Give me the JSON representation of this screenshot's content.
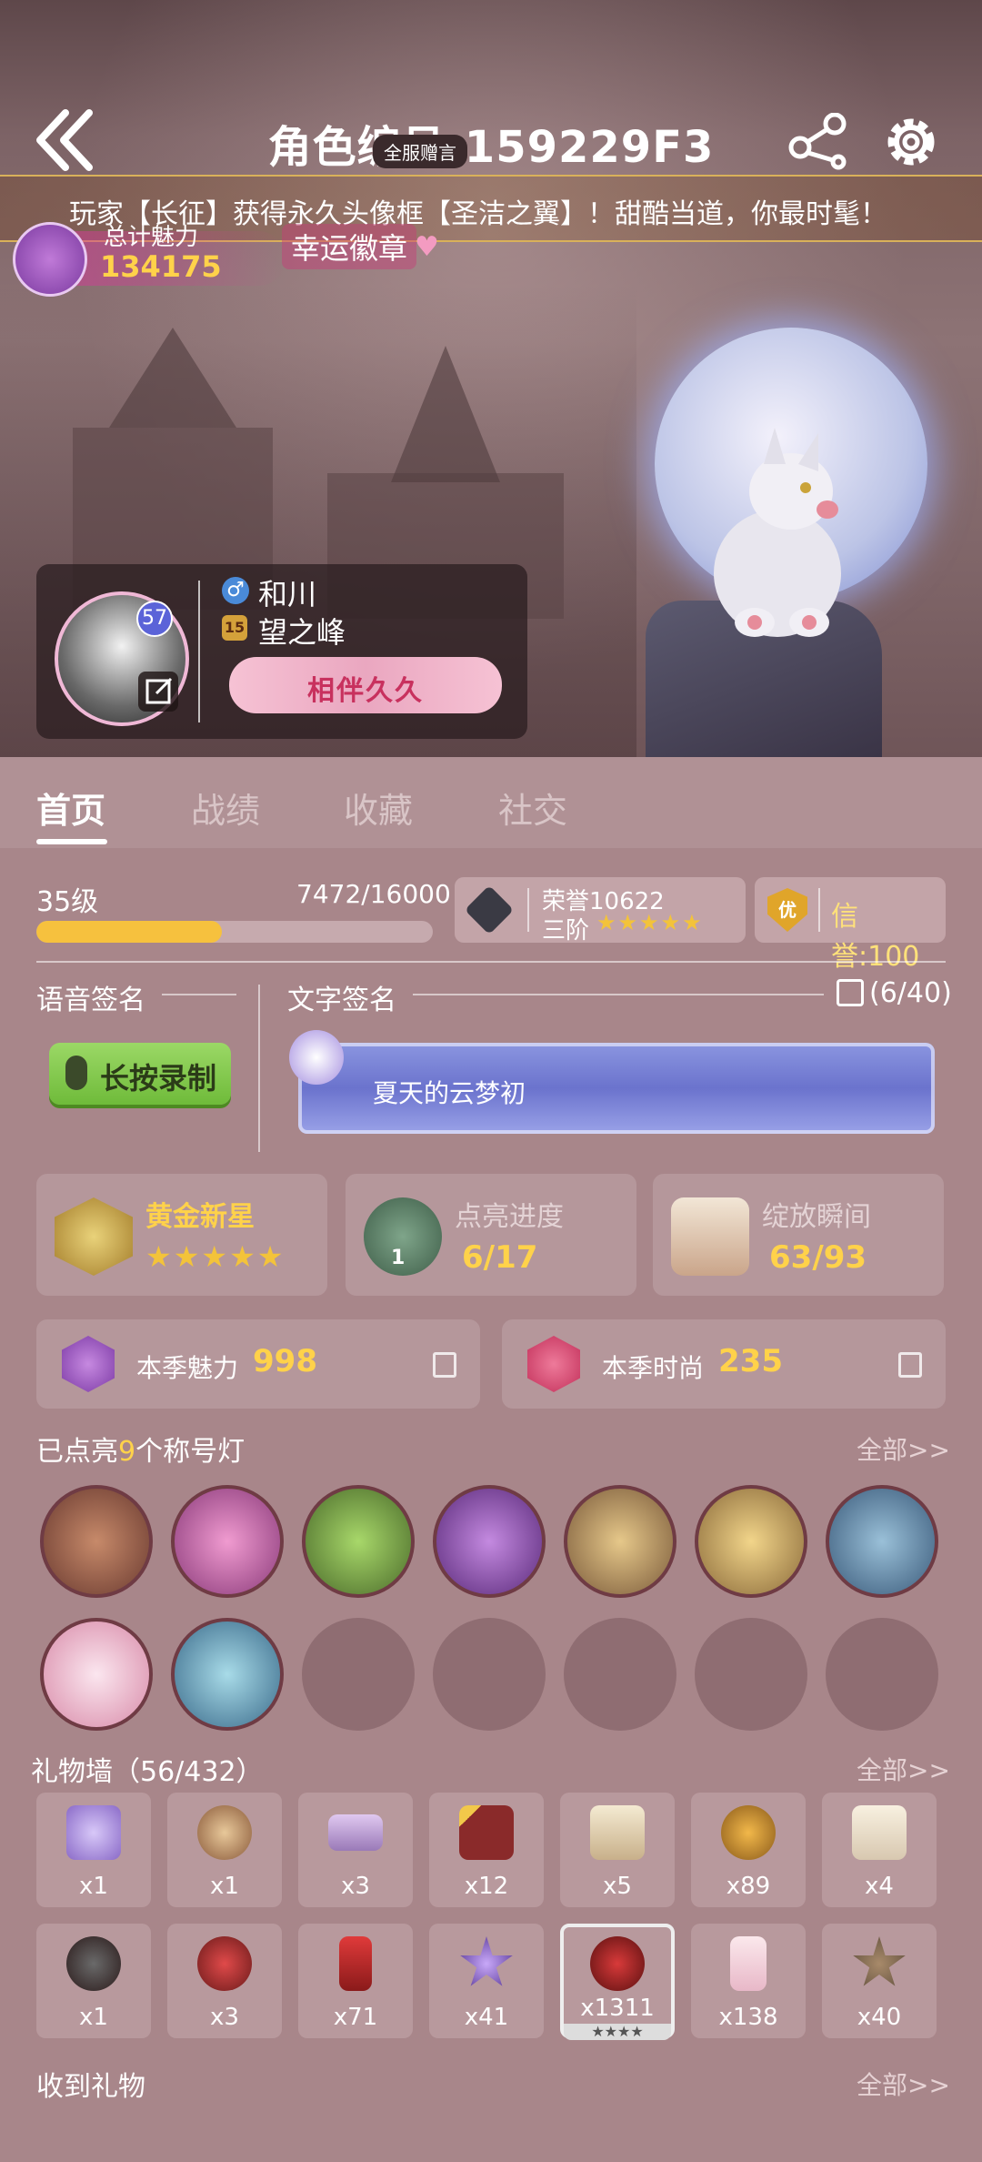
{
  "header": {
    "title": "角色编号:159229F3",
    "global_gift_tag": "全服赠言",
    "broadcast": "玩家【长征】获得永久头像框【圣洁之翼】！甜酷当道，你最时髦！"
  },
  "charm": {
    "label": "总计魅力",
    "value": "134175"
  },
  "lucky_badge": "幸运徽章",
  "profile": {
    "avatar_level": "57",
    "nickname": "和川",
    "guild_level": "15",
    "guild_name": "望之峰",
    "partner_banner": "相伴久久"
  },
  "tabs": [
    "首页",
    "战绩",
    "收藏",
    "社交"
  ],
  "level": {
    "label": "35级",
    "exp": "7472/16000",
    "progress": 0.467
  },
  "honor": {
    "label": "荣誉10622",
    "rank": "三阶",
    "stars": "★★★★★"
  },
  "credit": {
    "badge": "优",
    "text": "信誉:100"
  },
  "voice_signature": {
    "title": "语音签名",
    "button": "长按录制"
  },
  "text_signature": {
    "title": "文字签名",
    "count": "(6/40)",
    "text": "夏天的云梦初"
  },
  "achievements": [
    {
      "title": "黄金新星",
      "stars": "★★★★★"
    },
    {
      "title": "点亮进度",
      "value": "6/17",
      "badge": "1"
    },
    {
      "title": "绽放瞬间",
      "value": "63/93"
    }
  ],
  "season": [
    {
      "label": "本季魅力",
      "value": "998"
    },
    {
      "label": "本季时尚",
      "value": "235"
    }
  ],
  "title_lamps": {
    "prefix": "已点亮",
    "count": "9",
    "suffix": "个称号灯",
    "more": "全部>>"
  },
  "gift_wall": {
    "title": "礼物墙（56/432）",
    "more": "全部>>",
    "row1": [
      "x1",
      "x1",
      "x3",
      "x12",
      "x5",
      "x89",
      "x4"
    ],
    "row2": [
      "x1",
      "x3",
      "x71",
      "x41",
      "x1311",
      "x138",
      "x40"
    ]
  },
  "received_gifts": {
    "title": "收到礼物",
    "more": "全部>>"
  },
  "colors": {
    "accent_gold": "#ffd24a",
    "exp_fill": "#f6c13e",
    "record_green": "#8ccf52"
  }
}
